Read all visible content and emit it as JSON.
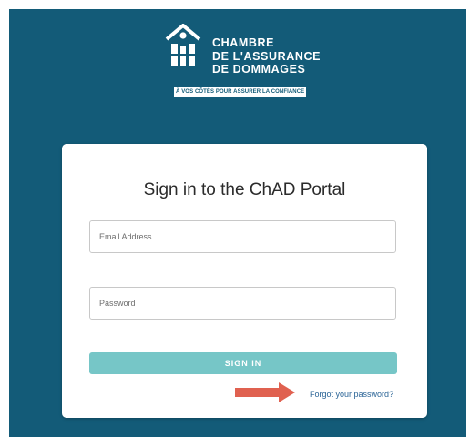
{
  "logo": {
    "line1": "CHAMBRE",
    "line2": "DE L'ASSURANCE",
    "line3": "DE DOMMAGES",
    "tagline": "À VOS CÔTÉS POUR ASSURER LA CONFIANCE"
  },
  "login": {
    "title": "Sign in to the ChAD Portal",
    "email_placeholder": "Email Address",
    "email_value": "",
    "password_placeholder": "Password",
    "password_value": "",
    "signin_label": "SIGN IN",
    "forgot_label": "Forgot your password?"
  },
  "annotation": {
    "arrow_icon": "right-arrow-icon",
    "arrow_color": "#e06150"
  },
  "colors": {
    "background": "#135b78",
    "button": "#76c6c7",
    "link": "#2a6496"
  }
}
